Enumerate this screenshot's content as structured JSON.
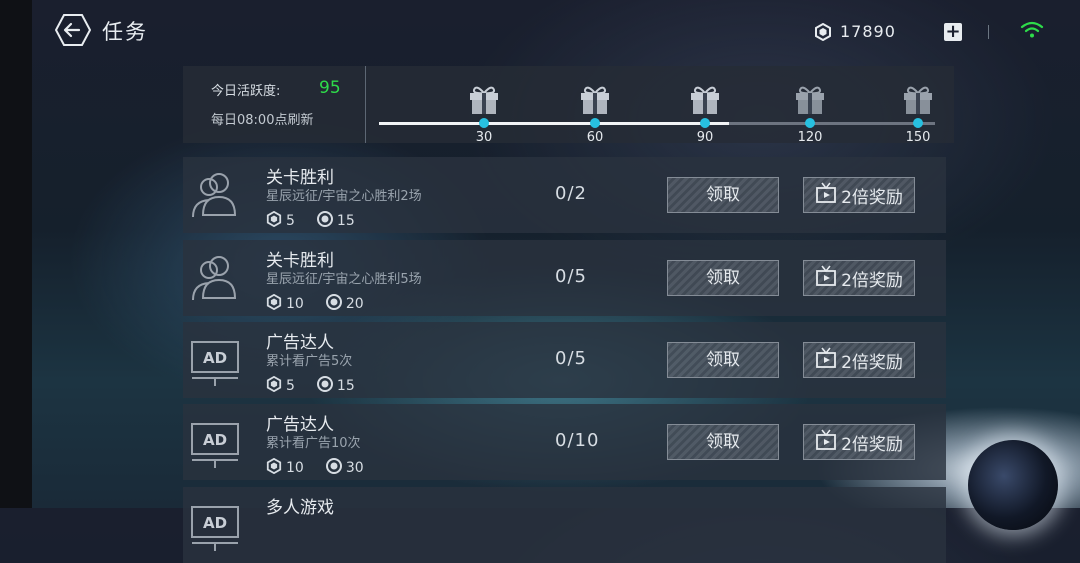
{
  "header": {
    "title": "任务",
    "currency_value": "17890"
  },
  "activity": {
    "label": "今日活跃度:",
    "value": "95",
    "refresh_text": "每日08:00点刷新",
    "progress_fraction": 0.63,
    "milestones": [
      {
        "label": "30",
        "reached": true
      },
      {
        "label": "60",
        "reached": true
      },
      {
        "label": "90",
        "reached": true
      },
      {
        "label": "120",
        "reached": false
      },
      {
        "label": "150",
        "reached": false
      }
    ]
  },
  "tasks": [
    {
      "icon": "people-icon",
      "title": "关卡胜利",
      "desc": "星辰远征/宇宙之心胜利2场",
      "reward_gem": "5",
      "reward_coin": "15",
      "progress": "0/2",
      "claim": "领取",
      "double": "2倍奖励"
    },
    {
      "icon": "people-icon",
      "title": "关卡胜利",
      "desc": "星辰远征/宇宙之心胜利5场",
      "reward_gem": "10",
      "reward_coin": "20",
      "progress": "0/5",
      "claim": "领取",
      "double": "2倍奖励"
    },
    {
      "icon": "ad-icon",
      "title": "广告达人",
      "desc": "累计看广告5次",
      "reward_gem": "5",
      "reward_coin": "15",
      "progress": "0/5",
      "claim": "领取",
      "double": "2倍奖励"
    },
    {
      "icon": "ad-icon",
      "title": "广告达人",
      "desc": "累计看广告10次",
      "reward_gem": "10",
      "reward_coin": "30",
      "progress": "0/10",
      "claim": "领取",
      "double": "2倍奖励"
    },
    {
      "icon": "ad-icon",
      "title": "多人游戏",
      "desc": "",
      "reward_gem": "",
      "reward_coin": "",
      "progress": "",
      "claim": "",
      "double": ""
    }
  ],
  "colors": {
    "accent_green": "#2edb4a",
    "milestone_dot": "#27c0e0"
  }
}
